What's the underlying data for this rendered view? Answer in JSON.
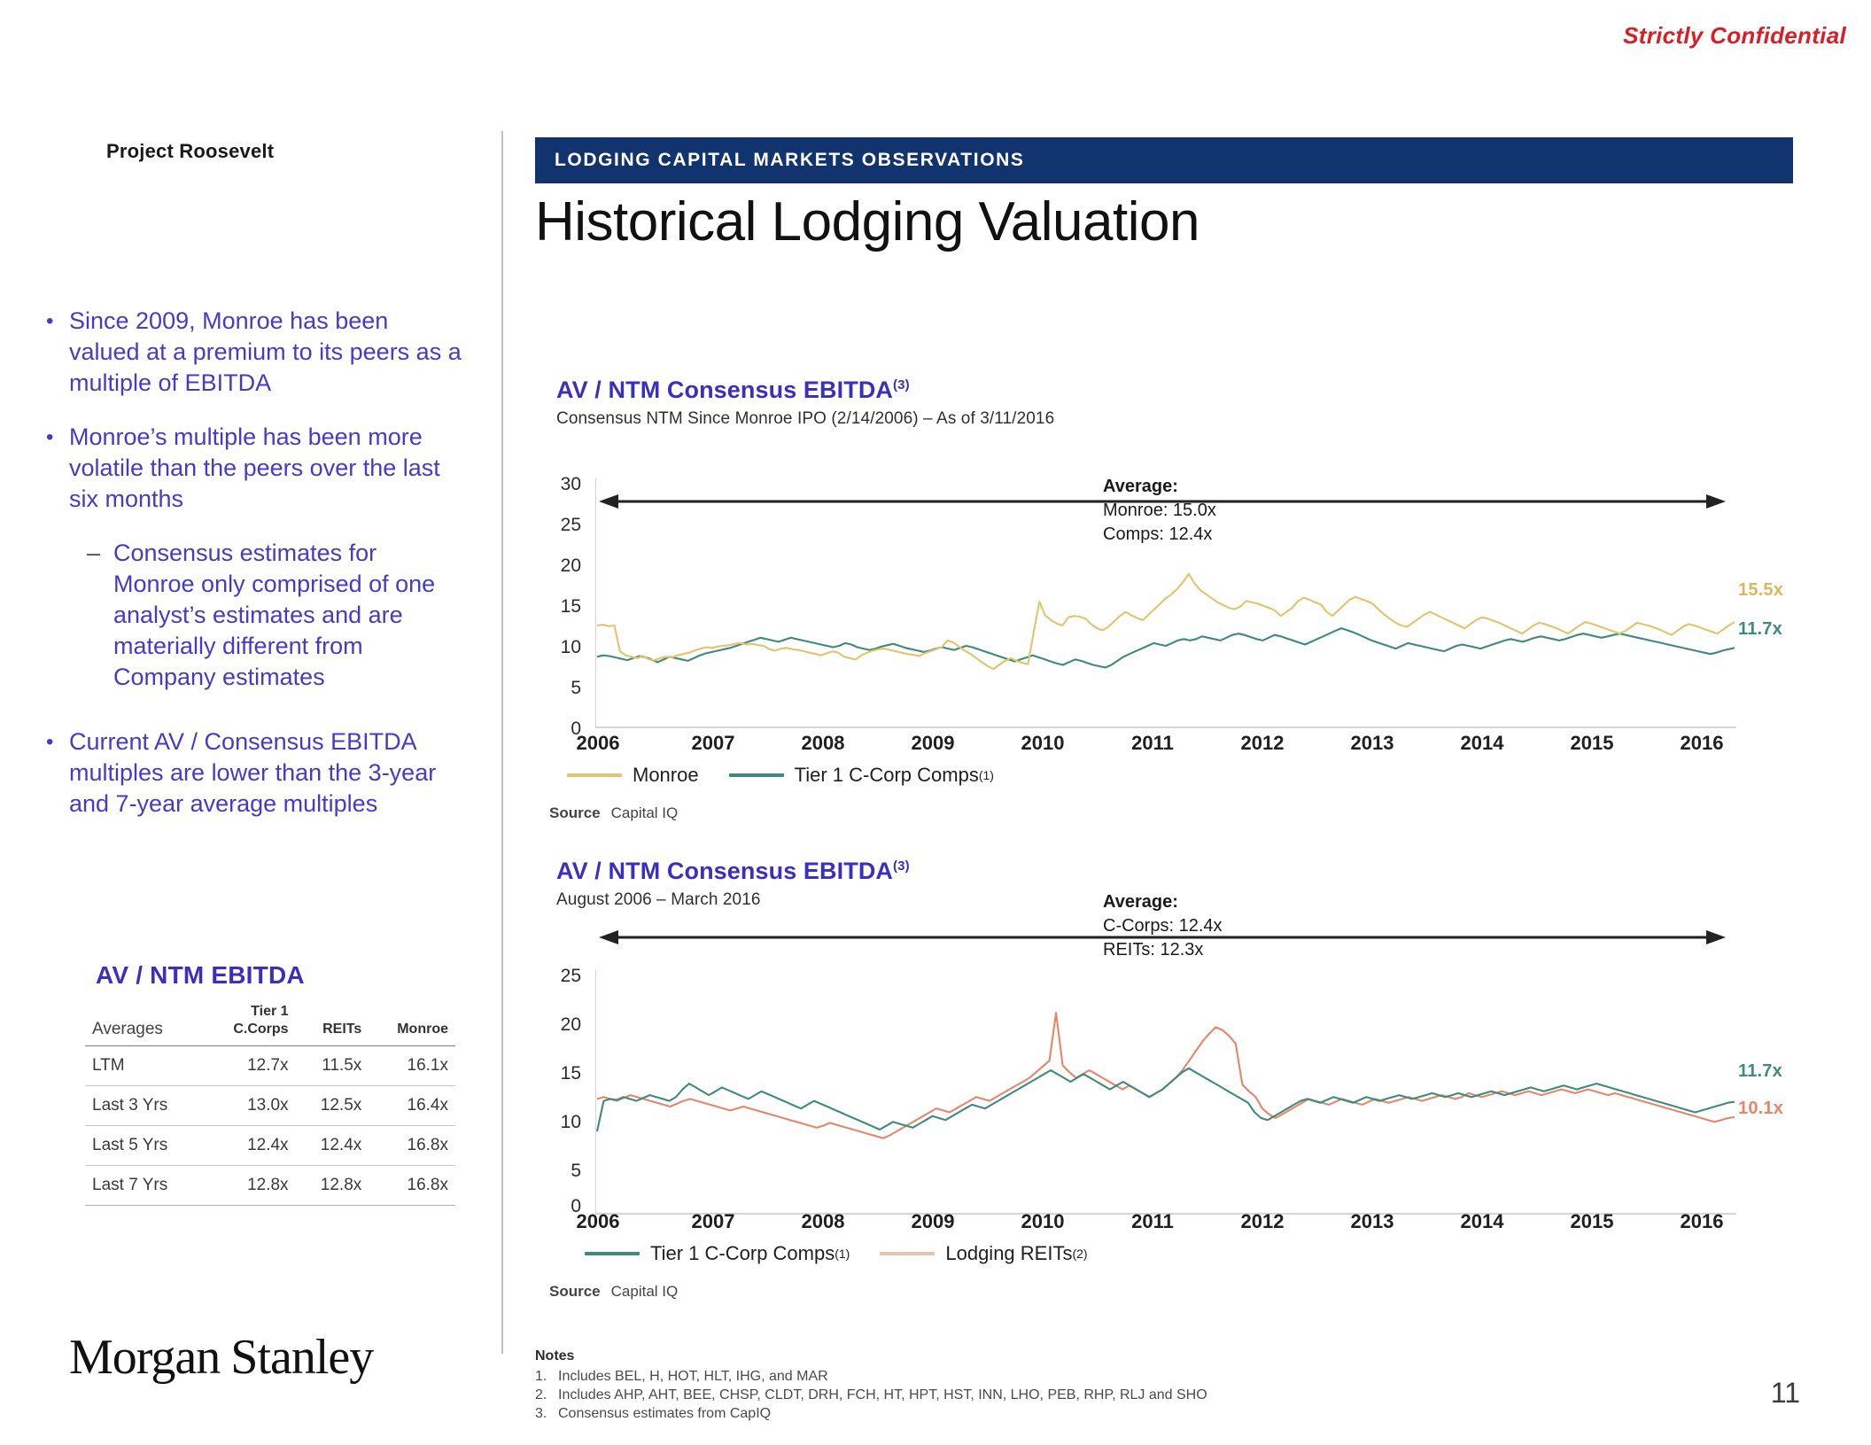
{
  "header": {
    "confidential": "Strictly Confidential",
    "project_label": "Project Roosevelt",
    "banner": "LODGING CAPITAL MARKETS OBSERVATIONS",
    "title": "Historical Lodging Valuation"
  },
  "sidebar": {
    "bullets": [
      {
        "mark": "•",
        "text": "Since 2009, Monroe has been valued at a premium to its peers as a multiple of EBITDA",
        "level": 1
      },
      {
        "mark": "•",
        "text": "Monroe’s multiple has been more volatile than the peers over the last six months",
        "level": 1
      },
      {
        "mark": "–",
        "text": "Consensus estimates for Monroe only comprised of one analyst’s estimates and are materially different from Company estimates",
        "level": 2
      },
      {
        "mark": "•",
        "text": "Current AV / Consensus EBITDA multiples are lower than the 3-year and 7-year average multiples",
        "level": 1
      }
    ],
    "table": {
      "title": "AV / NTM EBITDA",
      "columns": [
        "Averages",
        "Tier 1\nC.Corps",
        "REITs",
        "Monroe"
      ],
      "col_lead": "Averages",
      "col_tier1_line1": "Tier 1",
      "col_tier1_line2": "C.Corps",
      "col_reits": "REITs",
      "col_monroe": "Monroe",
      "rows": [
        {
          "label": "LTM",
          "ccorps": "12.7x",
          "reits": "11.5x",
          "monroe": "16.1x"
        },
        {
          "label": "Last 3 Yrs",
          "ccorps": "13.0x",
          "reits": "12.5x",
          "monroe": "16.4x"
        },
        {
          "label": "Last 5 Yrs",
          "ccorps": "12.4x",
          "reits": "12.4x",
          "monroe": "16.8x"
        },
        {
          "label": "Last 7 Yrs",
          "ccorps": "12.8x",
          "reits": "12.8x",
          "monroe": "16.8x"
        }
      ]
    },
    "logo_first": "Morgan",
    "logo_second": "Stanley"
  },
  "footer": {
    "notes_heading": "Notes",
    "notes": [
      {
        "num": "1.",
        "text": "Includes BEL, H, HOT, HLT, IHG, and MAR"
      },
      {
        "num": "2.",
        "text": "Includes AHP, AHT, BEE, CHSP, CLDT, DRH, FCH, HT, HPT, HST, INN, LHO, PEB, RHP, RLJ and SHO"
      },
      {
        "num": "3.",
        "text": "Consensus estimates from CapIQ"
      }
    ],
    "page_number": "11"
  },
  "colors": {
    "monroe": "#E3C36B",
    "ccorps": "#3E8B7C",
    "reits": "#E8856B",
    "banner": "#12346E",
    "accent_text": "#3B2FC0",
    "confidential": "#D81E26"
  },
  "chart_data": [
    {
      "id": "chart-top",
      "type": "line",
      "title": "AV / NTM Consensus EBITDA",
      "title_sup": "(3)",
      "subtitle": "Consensus NTM Since Monroe IPO (2/14/2006) – As of 3/11/2016",
      "xlabel": "",
      "ylabel": "",
      "ylim": [
        0,
        30
      ],
      "yticks": [
        0,
        5,
        10,
        15,
        20,
        25,
        30
      ],
      "ytick_labels": [
        "0",
        "5",
        "10",
        "15",
        "20",
        "25",
        "30"
      ],
      "grid": false,
      "legend_position": "bottom-left",
      "x": [
        2006.0,
        2016.2
      ],
      "xticks": [
        2006,
        2007,
        2008,
        2009,
        2010,
        2011,
        2012,
        2013,
        2014,
        2015,
        2016
      ],
      "xtick_labels": [
        "2006",
        "2007",
        "2008",
        "2009",
        "2010",
        "2011",
        "2012",
        "2013",
        "2014",
        "2015",
        "2016"
      ],
      "annotations": {
        "average_heading": "Average:",
        "average_lines": [
          "Monroe: 15.0x",
          "Comps: 12.4x"
        ],
        "arrow": "double-headed horizontal arrow spanning full period"
      },
      "end_labels": [
        {
          "series": "Monroe",
          "value": "15.5x",
          "color": "#E3C36B"
        },
        {
          "series": "Tier 1 C-Corp Comps",
          "value": "11.7x",
          "color": "#3E8B7C"
        }
      ],
      "series": [
        {
          "name": "Monroe",
          "color": "#E3C36B",
          "values": [
            15.0,
            15.1,
            14.9,
            15.0,
            11.2,
            10.6,
            10.4,
            10.2,
            10.5,
            10.0,
            9.9,
            10.2,
            10.4,
            10.3,
            10.6,
            10.8,
            11.0,
            11.3,
            11.6,
            11.8,
            11.7,
            11.9,
            12.0,
            12.1,
            12.3,
            12.4,
            12.2,
            12.3,
            12.1,
            12.0,
            11.5,
            11.3,
            11.6,
            11.7,
            11.5,
            11.4,
            11.2,
            11.0,
            10.8,
            10.6,
            10.9,
            11.2,
            11.0,
            10.4,
            10.2,
            10.0,
            10.6,
            11.0,
            11.3,
            11.5,
            11.6,
            11.4,
            11.2,
            11.0,
            10.8,
            10.7,
            10.5,
            10.9,
            11.2,
            11.5,
            11.8,
            12.8,
            12.5,
            11.9,
            11.3,
            10.8,
            10.2,
            9.6,
            9.0,
            8.6,
            9.2,
            9.8,
            10.2,
            9.8,
            9.5,
            9.3,
            14.0,
            18.5,
            16.5,
            15.8,
            15.3,
            15.0,
            16.2,
            16.4,
            16.3,
            16.0,
            15.2,
            14.6,
            14.3,
            14.8,
            15.6,
            16.4,
            17.0,
            16.5,
            16.1,
            15.8,
            16.6,
            17.4,
            18.2,
            19.0,
            19.6,
            20.4,
            21.4,
            22.6,
            21.2,
            20.2,
            19.6,
            19.0,
            18.4,
            18.0,
            17.6,
            17.4,
            17.8,
            18.6,
            18.4,
            18.2,
            17.9,
            17.6,
            17.2,
            16.4,
            17.0,
            17.6,
            18.6,
            19.1,
            18.8,
            18.4,
            18.1,
            17.0,
            16.4,
            17.2,
            18.0,
            18.8,
            19.2,
            18.9,
            18.6,
            18.2,
            17.4,
            16.6,
            16.0,
            15.4,
            15.0,
            14.8,
            15.4,
            16.0,
            16.6,
            17.0,
            16.6,
            16.2,
            15.8,
            15.4,
            15.0,
            14.6,
            15.2,
            15.8,
            16.2,
            16.0,
            15.7,
            15.4,
            15.0,
            14.6,
            14.2,
            13.8,
            14.4,
            15.0,
            15.4,
            15.2,
            14.9,
            14.6,
            14.2,
            13.8,
            14.4,
            15.0,
            15.5,
            15.3,
            15.0,
            14.7,
            14.4,
            14.1,
            13.8,
            14.2,
            14.8,
            15.4,
            15.2,
            15.0,
            14.7,
            14.4,
            14.0,
            13.6,
            14.2,
            14.8,
            15.2,
            15.0,
            14.7,
            14.4,
            14.1,
            13.8,
            14.4,
            15.0,
            15.5
          ]
        },
        {
          "name": "Tier 1 C-Corp Comps",
          "color": "#3E8B7C",
          "values": [
            10.4,
            10.6,
            10.5,
            10.3,
            10.1,
            9.9,
            10.2,
            10.5,
            10.3,
            10.0,
            9.6,
            10.0,
            10.4,
            10.2,
            10.0,
            9.8,
            10.2,
            10.6,
            10.9,
            11.1,
            11.3,
            11.5,
            11.7,
            12.0,
            12.3,
            12.6,
            12.9,
            13.2,
            13.0,
            12.8,
            12.6,
            12.9,
            13.2,
            13.0,
            12.8,
            12.6,
            12.4,
            12.2,
            12.0,
            11.8,
            12.0,
            12.4,
            12.2,
            11.8,
            11.6,
            11.4,
            11.6,
            11.9,
            12.1,
            12.3,
            12.0,
            11.7,
            11.5,
            11.3,
            11.1,
            11.3,
            11.6,
            11.8,
            11.6,
            11.4,
            11.7,
            12.0,
            11.8,
            11.5,
            11.2,
            10.9,
            10.6,
            10.3,
            10.0,
            9.7,
            10.0,
            10.3,
            10.6,
            10.3,
            10.0,
            9.7,
            9.4,
            9.2,
            9.6,
            10.0,
            9.8,
            9.5,
            9.2,
            9.0,
            8.8,
            9.2,
            9.8,
            10.4,
            10.8,
            11.2,
            11.6,
            12.0,
            12.4,
            12.2,
            12.0,
            12.4,
            12.8,
            13.0,
            12.8,
            13.0,
            13.4,
            13.2,
            13.0,
            12.8,
            13.2,
            13.6,
            13.8,
            13.6,
            13.3,
            13.0,
            12.8,
            13.2,
            13.6,
            13.4,
            13.1,
            12.8,
            12.5,
            12.2,
            12.6,
            13.0,
            13.4,
            13.8,
            14.2,
            14.6,
            14.3,
            14.0,
            13.6,
            13.2,
            12.8,
            12.5,
            12.2,
            11.9,
            11.6,
            12.0,
            12.4,
            12.2,
            12.0,
            11.8,
            11.6,
            11.4,
            11.2,
            11.6,
            12.0,
            12.2,
            12.0,
            11.8,
            11.6,
            11.9,
            12.2,
            12.5,
            12.8,
            13.0,
            12.8,
            12.6,
            12.9,
            13.2,
            13.4,
            13.2,
            13.0,
            12.8,
            13.0,
            13.3,
            13.6,
            13.8,
            13.6,
            13.4,
            13.2,
            13.4,
            13.6,
            13.8,
            13.6,
            13.4,
            13.2,
            13.0,
            12.8,
            12.6,
            12.4,
            12.2,
            12.0,
            11.8,
            11.6,
            11.4,
            11.2,
            11.0,
            10.8,
            11.0,
            11.3,
            11.5,
            11.7
          ]
        }
      ],
      "legend": [
        {
          "label": "Monroe",
          "color": "#E3C36B",
          "sup": ""
        },
        {
          "label": "Tier 1 C-Corp Comps",
          "color": "#3E8B7C",
          "sup": "(1)"
        }
      ],
      "source_label": "Source",
      "source_value": "Capital IQ"
    },
    {
      "id": "chart-bottom",
      "type": "line",
      "title": "AV / NTM Consensus EBITDA",
      "title_sup": "(3)",
      "subtitle": "August 2006 – March 2016",
      "xlabel": "",
      "ylabel": "",
      "ylim": [
        0,
        25
      ],
      "yticks": [
        0,
        5,
        10,
        15,
        20,
        25
      ],
      "ytick_labels": [
        "0",
        "5",
        "10",
        "15",
        "20",
        "25"
      ],
      "grid": false,
      "legend_position": "bottom-left",
      "x": [
        2006.0,
        2016.2
      ],
      "xticks": [
        2006,
        2007,
        2008,
        2009,
        2010,
        2011,
        2012,
        2013,
        2014,
        2015,
        2016
      ],
      "xtick_labels": [
        "2006",
        "2007",
        "2008",
        "2009",
        "2010",
        "2011",
        "2012",
        "2013",
        "2014",
        "2015",
        "2016"
      ],
      "annotations": {
        "average_heading": "Average:",
        "average_lines": [
          "C-Corps: 12.4x",
          "REITs: 12.3x"
        ],
        "arrow": "double-headed horizontal arrow spanning full period"
      },
      "end_labels": [
        {
          "series": "Tier 1 C-Corp Comps",
          "value": "11.7x",
          "color": "#3E8B7C"
        },
        {
          "series": "Lodging REITs",
          "value": "10.1x",
          "color": "#E8856B"
        }
      ],
      "series": [
        {
          "name": "Tier 1 C-Corp Comps",
          "color": "#3E8B7C",
          "values": [
            8.6,
            11.8,
            12.0,
            11.9,
            12.2,
            12.0,
            11.8,
            12.1,
            12.4,
            12.2,
            12.0,
            11.8,
            12.2,
            13.0,
            13.6,
            13.2,
            12.8,
            12.4,
            12.8,
            13.2,
            12.9,
            12.6,
            12.3,
            12.0,
            12.4,
            12.8,
            12.5,
            12.2,
            11.9,
            11.6,
            11.3,
            11.0,
            11.4,
            11.8,
            11.5,
            11.2,
            10.9,
            10.6,
            10.3,
            10.0,
            9.7,
            9.4,
            9.1,
            8.8,
            9.2,
            9.6,
            9.4,
            9.2,
            9.0,
            9.4,
            9.8,
            10.2,
            10.0,
            9.8,
            10.2,
            10.6,
            11.0,
            11.4,
            11.2,
            11.0,
            11.4,
            11.8,
            12.2,
            12.6,
            13.0,
            13.4,
            13.8,
            14.2,
            14.6,
            15.0,
            14.6,
            14.2,
            13.8,
            14.2,
            14.6,
            14.2,
            13.8,
            13.4,
            13.0,
            13.4,
            13.8,
            13.4,
            13.0,
            12.6,
            12.2,
            12.6,
            13.0,
            13.6,
            14.2,
            14.8,
            15.2,
            14.8,
            14.4,
            14.0,
            13.6,
            13.2,
            12.8,
            12.4,
            12.0,
            11.6,
            10.6,
            10.0,
            9.8,
            10.2,
            10.6,
            11.0,
            11.4,
            11.8,
            12.0,
            11.8,
            11.6,
            11.9,
            12.2,
            12.0,
            11.8,
            11.6,
            11.9,
            12.2,
            12.0,
            11.8,
            12.0,
            12.2,
            12.4,
            12.2,
            12.0,
            12.2,
            12.4,
            12.6,
            12.4,
            12.2,
            12.4,
            12.6,
            12.4,
            12.2,
            12.4,
            12.6,
            12.8,
            12.6,
            12.4,
            12.6,
            12.8,
            13.0,
            13.2,
            13.0,
            12.8,
            13.0,
            13.2,
            13.4,
            13.2,
            13.0,
            13.2,
            13.4,
            13.6,
            13.4,
            13.2,
            13.0,
            12.8,
            12.6,
            12.4,
            12.2,
            12.0,
            11.8,
            11.6,
            11.4,
            11.2,
            11.0,
            10.8,
            10.6,
            10.8,
            11.0,
            11.2,
            11.4,
            11.6,
            11.7
          ]
        },
        {
          "name": "Lodging REITs",
          "color": "#E8856B",
          "values": [
            12.0,
            12.2,
            12.0,
            11.8,
            12.1,
            12.4,
            12.2,
            12.0,
            11.8,
            11.6,
            11.4,
            11.2,
            11.5,
            11.8,
            12.0,
            11.8,
            11.6,
            11.4,
            11.2,
            11.0,
            10.8,
            11.0,
            11.2,
            11.0,
            10.8,
            10.6,
            10.4,
            10.2,
            10.0,
            9.8,
            9.6,
            9.4,
            9.2,
            9.0,
            9.2,
            9.5,
            9.3,
            9.1,
            8.9,
            8.7,
            8.5,
            8.3,
            8.1,
            7.9,
            8.2,
            8.6,
            9.0,
            9.4,
            9.8,
            10.2,
            10.6,
            11.0,
            10.8,
            10.6,
            11.0,
            11.4,
            11.8,
            12.2,
            12.0,
            11.8,
            12.2,
            12.6,
            13.0,
            13.4,
            13.8,
            14.2,
            14.8,
            15.4,
            16.0,
            21.0,
            15.5,
            14.8,
            14.2,
            14.6,
            15.0,
            14.6,
            14.2,
            13.8,
            13.4,
            13.0,
            13.4,
            13.0,
            12.6,
            12.2,
            12.6,
            13.0,
            13.6,
            14.2,
            15.0,
            16.0,
            17.0,
            18.0,
            18.8,
            19.5,
            19.2,
            18.6,
            17.8,
            13.5,
            12.8,
            12.2,
            11.0,
            10.4,
            10.0,
            10.4,
            10.8,
            11.2,
            11.6,
            12.0,
            11.8,
            11.6,
            11.4,
            11.7,
            12.0,
            11.8,
            11.6,
            11.4,
            11.7,
            12.0,
            11.8,
            11.6,
            11.8,
            12.0,
            12.2,
            12.0,
            11.8,
            12.0,
            12.2,
            12.4,
            12.2,
            12.0,
            12.2,
            12.6,
            12.4,
            12.2,
            12.4,
            12.6,
            12.8,
            12.6,
            12.4,
            12.6,
            12.8,
            12.6,
            12.4,
            12.6,
            12.8,
            13.0,
            12.8,
            12.6,
            12.8,
            13.0,
            12.8,
            12.6,
            12.4,
            12.6,
            12.4,
            12.2,
            12.0,
            11.8,
            11.6,
            11.4,
            11.2,
            11.0,
            10.8,
            10.6,
            10.4,
            10.2,
            10.0,
            9.8,
            9.6,
            9.8,
            10.0,
            10.1
          ]
        }
      ],
      "legend": [
        {
          "label": "Tier 1 C-Corp Comps",
          "color": "#3E8B7C",
          "sup": "(1)"
        },
        {
          "label": "Lodging REITs",
          "color": "#E8856B",
          "sup": "(2)"
        }
      ],
      "source_label": "Source",
      "source_value": "Capital IQ"
    }
  ]
}
